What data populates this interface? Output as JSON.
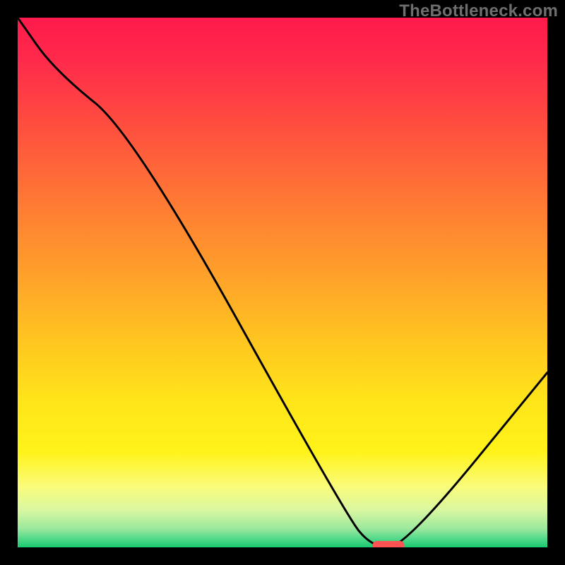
{
  "watermark": "TheBottleneck.com",
  "colors": {
    "frame": "#000000",
    "curve": "#000000",
    "marker": "#ff5252",
    "gradient_stops": [
      {
        "offset": 0.0,
        "color": "#ff1a4b"
      },
      {
        "offset": 0.08,
        "color": "#ff2a4b"
      },
      {
        "offset": 0.2,
        "color": "#ff4d3f"
      },
      {
        "offset": 0.35,
        "color": "#ff7a34"
      },
      {
        "offset": 0.5,
        "color": "#ffa529"
      },
      {
        "offset": 0.62,
        "color": "#ffc81f"
      },
      {
        "offset": 0.72,
        "color": "#ffe41a"
      },
      {
        "offset": 0.82,
        "color": "#fff31a"
      },
      {
        "offset": 0.885,
        "color": "#fafc7a"
      },
      {
        "offset": 0.93,
        "color": "#d9f7a1"
      },
      {
        "offset": 0.965,
        "color": "#9ae89d"
      },
      {
        "offset": 0.985,
        "color": "#4ed889"
      },
      {
        "offset": 1.0,
        "color": "#18c96f"
      }
    ]
  },
  "chart_data": {
    "type": "line",
    "title": "",
    "xlabel": "",
    "ylabel": "",
    "xlim": [
      0,
      100
    ],
    "ylim": [
      0,
      100
    ],
    "x": [
      0,
      7,
      22,
      62,
      67,
      73,
      100
    ],
    "values": [
      100,
      90,
      78,
      6,
      0,
      0,
      33
    ],
    "marker": {
      "x_start": 67,
      "x_end": 73,
      "y": 0
    },
    "notes": "Y-axis reads as bottleneck percentage (100 at top, 0 at bottom). Curve descends from top-left, flattens at zero around x≈67–73 (marker), then rises toward the right."
  }
}
